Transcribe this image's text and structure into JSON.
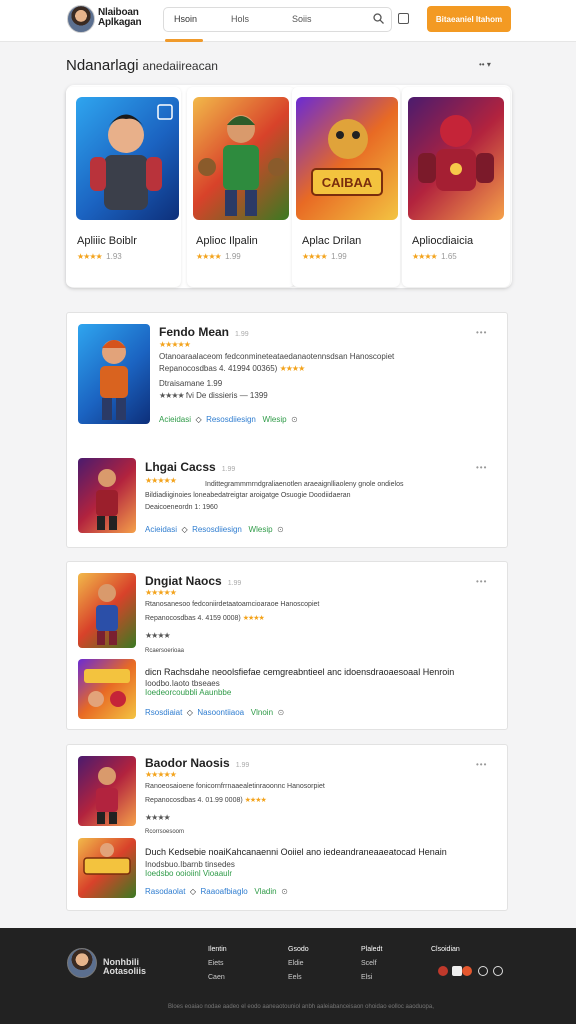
{
  "header": {
    "logo_line1": "Nlaiboan",
    "logo_line2": "Aplkagan",
    "tabs": [
      "Hsoin",
      "Hols",
      "Soiis"
    ],
    "cta_label": "Bitaeaniel Itahom"
  },
  "section": {
    "title": "Ndanarlagi",
    "subtitle": "anedaiireacan",
    "menu": "•• ▾"
  },
  "featured": [
    {
      "name": "Apliiic Boiblr",
      "stars": "★★★★",
      "count": "1.93"
    },
    {
      "name": "Aplioc Ilpalin",
      "stars": "★★★★",
      "count": "1.99"
    },
    {
      "name": "Aplac Drilan",
      "stars": "★★★★",
      "count": "1.99"
    },
    {
      "name": "Apliocdiaicia",
      "stars": "★★★★",
      "count": "1.65"
    }
  ],
  "list": {
    "panel1": {
      "row1": {
        "title": "Fendo Mean",
        "tag": "1.99",
        "stars": "★★★★★",
        "line1": "Otanoaraalaceom  fedconmineteataedanaotennsdsan Hanoscopiet",
        "line2": "Repanocosdbas  4. 41994  00365)",
        "line2_stars": "★★★★",
        "line3": "Dtraisamane 1.99",
        "line4_stars": "★★★★",
        "line4_text": "fvi   De dissieris — 1399"
      },
      "row2": {
        "title": "Lhgai Cacss",
        "tag": "1.99",
        "stars": "★★★★★",
        "line1": "Indittegrammmrndgraliaenotlen araeaignlliaoleny gnole ondielos",
        "line2": "Bildiadiiginoies  loneabedatreigtar  aroigatge Osuogie Doodiidaeran",
        "line3": "Deaicoeneordn 1: 1960"
      },
      "actions": [
        "Acieidasi",
        "Resosdiiesign",
        "Wlesip"
      ]
    },
    "panel2": {
      "row1": {
        "title": "Dngiat Naocs",
        "tag": "1.99",
        "stars": "★★★★★",
        "line1": "Rtanosanesoo  fedconiirdetaatoamcioaraoe Hanoscopiet",
        "line2": "Repanocosdbas  4. 4159   0008)",
        "line2_stars": "★★★★",
        "line3_stars": "★★★★",
        "line4": "Rcaersoerioaa"
      },
      "row2": {
        "title": "Dicn Rachsdahe",
        "line1": "dicn Rachsdahe neoolsfiefae cemgreabntieel anc idoensdraoaesoaal Henroin",
        "line2": "Ioodbo.Iaoto tbseaes",
        "line3": "Ioedeorcoubbli   Aaunbbe"
      },
      "actions": [
        "Rsosdiaiat",
        "Nasoontiiaoa",
        "Vlnoin"
      ]
    },
    "panel3": {
      "row1": {
        "title": "Baodor Naosis",
        "tag": "1.99",
        "stars": "★★★★★",
        "line1": "Ranoeosaioene  fonicornfrrnaaealetinraoonnc Hanosorpiet",
        "line2": "Repanocosdbas  4. 01.99  0008)",
        "line2_stars": "★★★★",
        "line3_stars": "★★★★",
        "line4": "Rcorrsoesoom"
      },
      "row2": {
        "title": "Duch Kedsebie",
        "line1": "Duch Kedsebie noaiKahcanaenni Ooiiel ano iedeandraneaaeatocad Henain",
        "line2": "Inodsbuo.Ibarnb tinsedes",
        "line3": "Ioedsbo ooioiinl   Vioaaulr"
      },
      "actions": [
        "Rasodaolat",
        "Raaoafbiaglo",
        "Vladin"
      ]
    }
  },
  "footer": {
    "logo_line1": "Nonhbili",
    "logo_line2": "Aotasoliis",
    "columns": [
      {
        "head": "Ilentin",
        "items": [
          "Eiets",
          "Caen"
        ]
      },
      {
        "head": "Gsodo",
        "items": [
          "Eldie",
          "Eels"
        ]
      },
      {
        "head": "Plaledt",
        "items": [
          "Scelf",
          "Elsi"
        ]
      },
      {
        "head": "Clsoidian",
        "items": []
      }
    ],
    "copyright": "Bloes eoaiao nodae aadeo el eodo aaneaotouniol anbh aaleiabanceisaon ohoidao eolloc aaoduopa,"
  },
  "colors": {
    "accent": "#f39a23",
    "green": "#2f9b48",
    "blue": "#2f7dd0",
    "footer_bg": "#222222"
  }
}
